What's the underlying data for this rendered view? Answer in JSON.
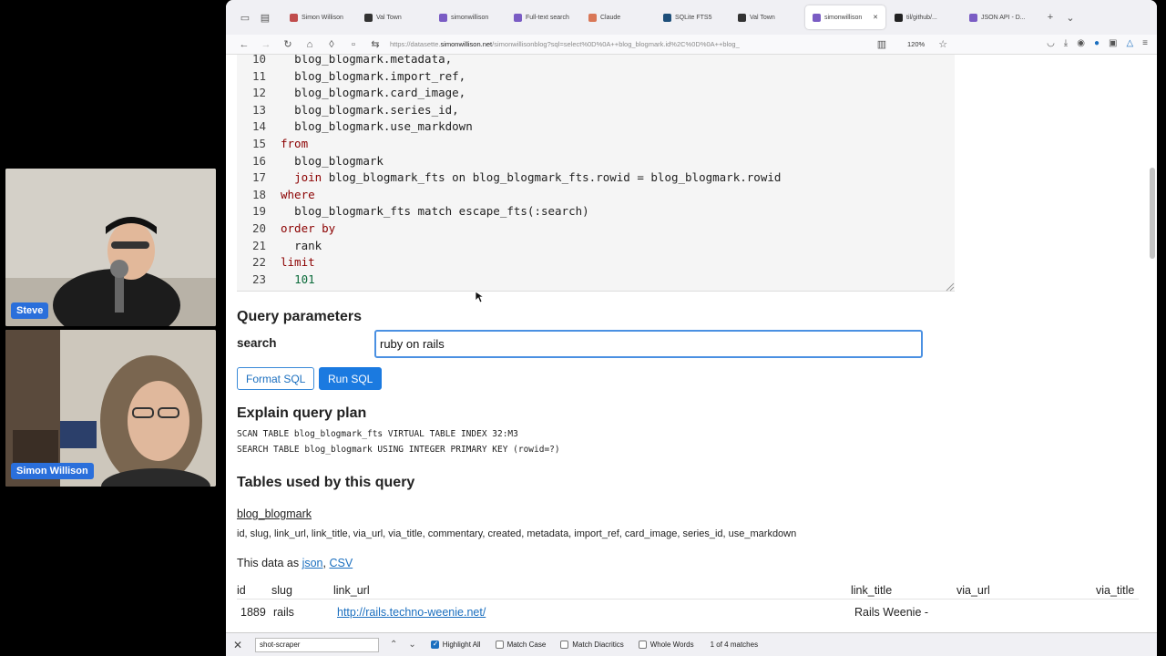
{
  "participants": [
    {
      "name": "Steve"
    },
    {
      "name": "Simon Willison"
    }
  ],
  "browser": {
    "tabs": [
      {
        "label": "Simon Willison",
        "color": "#c04c4c"
      },
      {
        "label": "Val Town",
        "color": "#333333"
      },
      {
        "label": "simonwillison",
        "color": "#7a5cc4"
      },
      {
        "label": "Full-text search",
        "color": "#7a5cc4"
      },
      {
        "label": "Claude",
        "color": "#d97757"
      },
      {
        "label": "SQLite FTS5",
        "color": "#1e4f7a"
      },
      {
        "label": "Val Town",
        "color": "#333333"
      },
      {
        "label": "simonwillison",
        "color": "#7a5cc4",
        "active": true
      },
      {
        "label": "til/github/...",
        "color": "#222222"
      },
      {
        "label": "JSON API - D...",
        "color": "#7a5cc4"
      }
    ],
    "url_prefix": "https://datasette.",
    "url_domain": "simonwillison.net",
    "url_rest": "/simonwillisonblog?sql=select%0D%0A++blog_blogmark.id%2C%0D%0A++blog_",
    "zoom": "120%"
  },
  "editor": {
    "lines": [
      {
        "n": "10",
        "indent": "  ",
        "code": "blog_blogmark.metadata,"
      },
      {
        "n": "11",
        "indent": "  ",
        "code": "blog_blogmark.import_ref,"
      },
      {
        "n": "12",
        "indent": "  ",
        "code": "blog_blogmark.card_image,"
      },
      {
        "n": "13",
        "indent": "  ",
        "code": "blog_blogmark.series_id,"
      },
      {
        "n": "14",
        "indent": "  ",
        "code": "blog_blogmark.use_markdown"
      },
      {
        "n": "15",
        "indent": "",
        "code": "from",
        "kw": true
      },
      {
        "n": "16",
        "indent": "  ",
        "code": "blog_blogmark"
      },
      {
        "n": "17",
        "indent": "  ",
        "code_kw": "join",
        "code": " blog_blogmark_fts on blog_blogmark_fts.rowid = blog_blogmark.rowid"
      },
      {
        "n": "18",
        "indent": "",
        "code": "where",
        "kw": true
      },
      {
        "n": "19",
        "indent": "  ",
        "code": "blog_blogmark_fts match escape_fts(:search)"
      },
      {
        "n": "20",
        "indent": "",
        "code": "order by",
        "kw": true
      },
      {
        "n": "21",
        "indent": "  ",
        "code": "rank"
      },
      {
        "n": "22",
        "indent": "",
        "code": "limit",
        "kw": true
      },
      {
        "n": "23",
        "indent": "  ",
        "code": "101",
        "num": true
      }
    ]
  },
  "query_params": {
    "heading": "Query parameters",
    "label": "search",
    "value": "ruby on rails"
  },
  "buttons": {
    "format": "Format SQL",
    "run": "Run SQL"
  },
  "explain": {
    "heading": "Explain query plan",
    "lines": [
      "SCAN TABLE blog_blogmark_fts VIRTUAL TABLE INDEX 32:M3",
      "SEARCH TABLE blog_blogmark USING INTEGER PRIMARY KEY (rowid=?)"
    ]
  },
  "tables_used": {
    "heading": "Tables used by this query",
    "table_name": "blog_blogmark",
    "columns": "id, slug, link_url, link_title, via_url, via_title, commentary, created, metadata, import_ref, card_image, series_id, use_markdown"
  },
  "data_as": {
    "prefix": "This data as ",
    "json": "json",
    "sep": ", ",
    "csv": "CSV"
  },
  "results": {
    "headers": [
      "id",
      "slug",
      "link_url",
      "link_title",
      "via_url",
      "via_title"
    ],
    "row": {
      "id": "1889",
      "slug": "rails",
      "link_url": "http://rails.techno-weenie.net/",
      "link_title": "Rails Weenie -"
    }
  },
  "findbar": {
    "query": "shot-scraper",
    "highlight_all": "Highlight All",
    "match_case": "Match Case",
    "match_diacritics": "Match Diacritics",
    "whole_words": "Whole Words",
    "match_count": "1 of 4 matches"
  }
}
